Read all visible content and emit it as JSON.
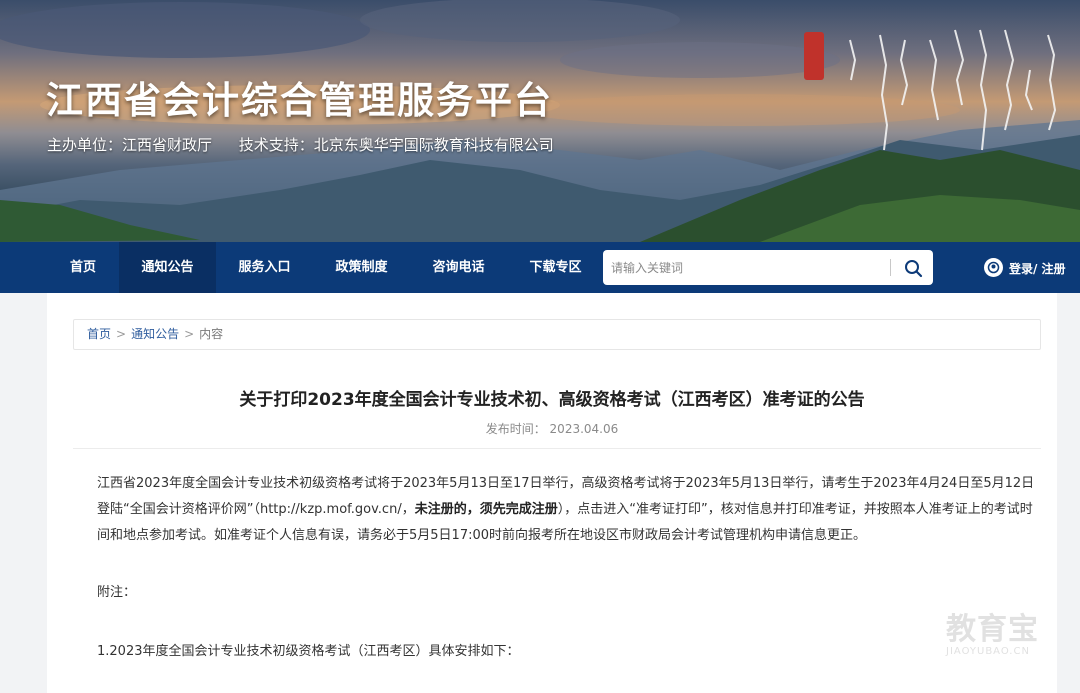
{
  "banner": {
    "title": "江西省会计综合管理服务平台",
    "host": "主办单位：江西省财政厅",
    "support": "技术支持：北京东奥华宇国际教育科技有限公司"
  },
  "nav": {
    "items": [
      {
        "label": "首页"
      },
      {
        "label": "通知公告"
      },
      {
        "label": "服务入口"
      },
      {
        "label": "政策制度"
      },
      {
        "label": "咨询电话"
      },
      {
        "label": "下载专区"
      }
    ],
    "active_index": 1,
    "search_placeholder": "请输入关键词",
    "login_label": "登录/ 注册",
    "bg_color": "#0c3a78"
  },
  "breadcrumb": {
    "home": "首页",
    "section": "通知公告",
    "current": "内容",
    "sep": ">"
  },
  "article": {
    "title": "关于打印2023年度全国会计专业技术初、高级资格考试（江西考区）准考证的公告",
    "publish": "发布时间： 2023.04.06",
    "para1_a": "江西省2023年度全国会计专业技术初级资格考试将于2023年5月13日至17日举行，高级资格考试将于2023年5月13日举行，请考生于2023年4月24日至5月12日登陆“全国会计资格评价网”（http://kzp.mof.gov.cn/，",
    "para1_bold": "未注册的，须先完成注册",
    "para1_b": "），点击进入“准考证打印”，核对信息并打印准考证，并按照本人准考证上的考试时间和地点参加考试。如准考证个人信息有误，请务必于5月5日17:00时前向报考所在地设区市财政局会计考试管理机构申请信息更正。",
    "note_label": "附注：",
    "item1": "1.2023年度全国会计专业技术初级资格考试（江西考区）具体安排如下："
  },
  "watermark": {
    "cn": "教育宝",
    "en": "JIAOYUBAO.CN"
  }
}
